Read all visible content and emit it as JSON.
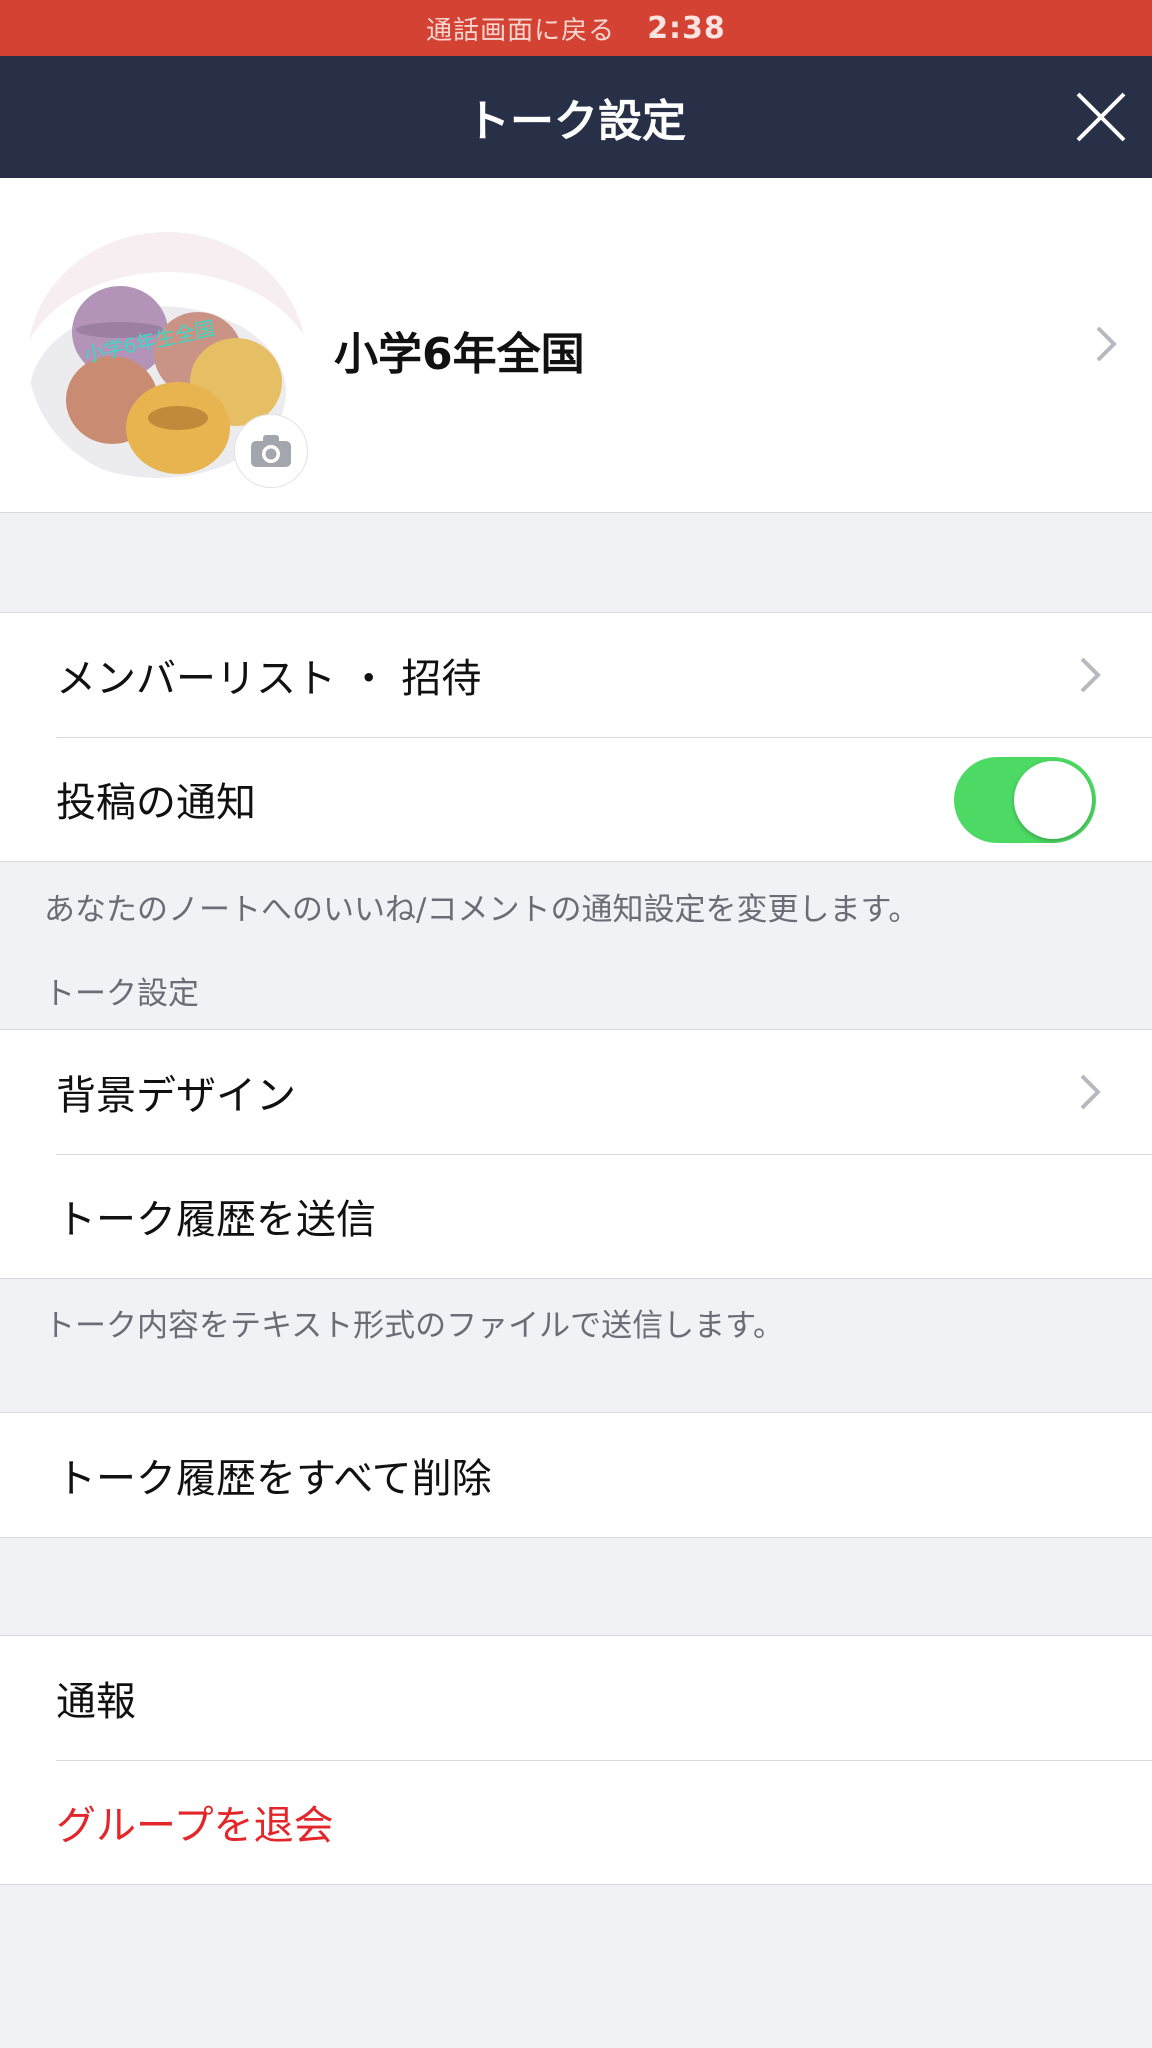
{
  "status_bar": {
    "return_label": "通話画面に戻る",
    "time": "2:38"
  },
  "nav": {
    "title": "トーク設定",
    "close_icon": "close-icon"
  },
  "profile": {
    "group_name": "小学6年全国",
    "avatar_caption": "小学6年生全国",
    "camera_icon": "camera-icon"
  },
  "members_section": {
    "member_list_label": "メンバーリスト ・ 招待",
    "post_notification_label": "投稿の通知",
    "post_notification_on": true
  },
  "post_notification_note": "あなたのノートへのいいね/コメントの通知設定を変更します。",
  "talk_settings_header": "トーク設定",
  "talk_section": {
    "background_label": "背景デザイン",
    "send_history_label": "トーク履歴を送信"
  },
  "send_history_note": "トーク内容をテキスト形式のファイルで送信します。",
  "delete_section": {
    "delete_all_label": "トーク履歴をすべて削除"
  },
  "report_section": {
    "report_label": "通報",
    "leave_group_label": "グループを退会"
  },
  "colors": {
    "status_bar": "#d44233",
    "nav_bar": "#273046",
    "toggle_on": "#4cd964",
    "danger": "#e3262a",
    "background": "#f1f2f6"
  }
}
